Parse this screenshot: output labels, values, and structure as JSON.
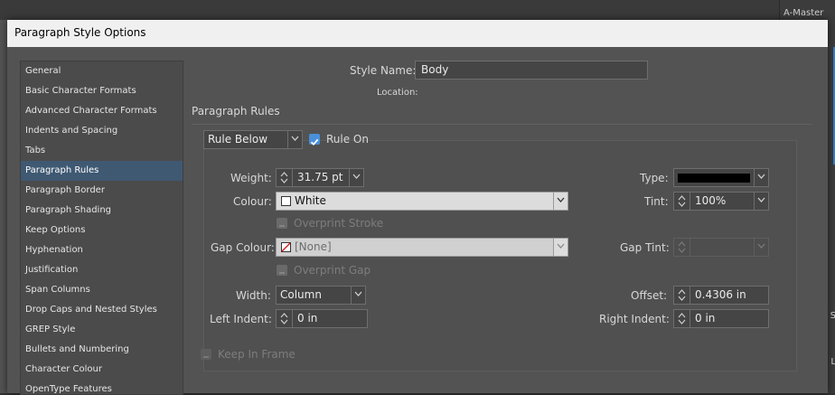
{
  "background": {
    "panel_label": "A-Master",
    "right_letter_1": "S",
    "right_letter_2": "L"
  },
  "dialog": {
    "title": "Paragraph Style Options"
  },
  "sidebar": {
    "items": [
      {
        "label": "General"
      },
      {
        "label": "Basic Character Formats"
      },
      {
        "label": "Advanced Character Formats"
      },
      {
        "label": "Indents and Spacing"
      },
      {
        "label": "Tabs"
      },
      {
        "label": "Paragraph Rules",
        "selected": true
      },
      {
        "label": "Paragraph Border"
      },
      {
        "label": "Paragraph Shading"
      },
      {
        "label": "Keep Options"
      },
      {
        "label": "Hyphenation"
      },
      {
        "label": "Justification"
      },
      {
        "label": "Span Columns"
      },
      {
        "label": "Drop Caps and Nested Styles"
      },
      {
        "label": "GREP Style"
      },
      {
        "label": "Bullets and Numbering"
      },
      {
        "label": "Character Colour"
      },
      {
        "label": "OpenType Features"
      }
    ]
  },
  "main": {
    "style_name_label": "Style Name:",
    "style_name_value": "Body",
    "location_label": "Location:",
    "section_title": "Paragraph Rules",
    "rule_type": "Rule Below",
    "rule_on_label": "Rule On",
    "rule_on_checked": true,
    "weight_label": "Weight:",
    "weight_value": "31.75 pt",
    "type_label": "Type:",
    "colour_label": "Colour:",
    "colour_value": "White",
    "tint_label": "Tint:",
    "tint_value": "100%",
    "overprint_stroke_label": "Overprint Stroke",
    "gap_colour_label": "Gap Colour:",
    "gap_colour_value": "[None]",
    "gap_tint_label": "Gap Tint:",
    "overprint_gap_label": "Overprint Gap",
    "width_label": "Width:",
    "width_value": "Column",
    "offset_label": "Offset:",
    "offset_value": "0.4306 in",
    "left_indent_label": "Left Indent:",
    "left_indent_value": "0 in",
    "right_indent_label": "Right Indent:",
    "right_indent_value": "0 in",
    "keep_in_frame_label": "Keep In Frame"
  },
  "colors": {
    "accent": "#4a90d9",
    "selection": "#3f5973",
    "stroke_type": "#000000"
  }
}
